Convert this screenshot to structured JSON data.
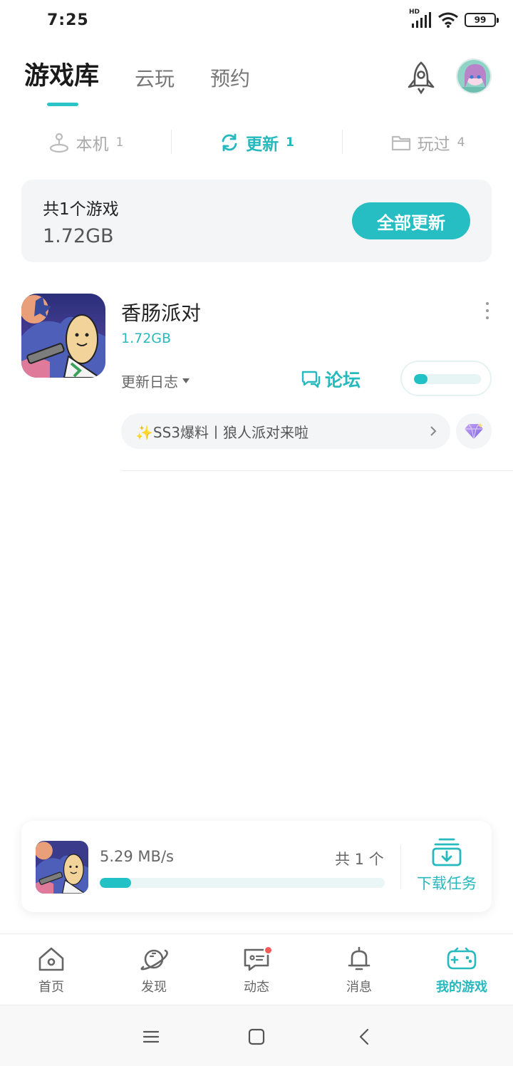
{
  "status_bar": {
    "time": "7:25",
    "network": "HD",
    "battery": "99"
  },
  "header": {
    "tabs": [
      {
        "label": "游戏库",
        "active": true
      },
      {
        "label": "云玩",
        "active": false
      },
      {
        "label": "预约",
        "active": false
      }
    ],
    "rocket_icon": "rocket-icon",
    "avatar_icon": "avatar"
  },
  "sub_tabs": [
    {
      "label": "本机",
      "count": "1",
      "icon": "device-icon",
      "active": false
    },
    {
      "label": "更新",
      "count": "1",
      "icon": "refresh-icon",
      "active": true
    },
    {
      "label": "玩过",
      "count": "4",
      "icon": "folder-icon",
      "active": false
    }
  ],
  "summary": {
    "title": "共1个游戏",
    "size": "1.72GB",
    "update_all": "全部更新"
  },
  "game": {
    "name": "香肠派对",
    "size": "1.72GB",
    "changelog": "更新日志",
    "forum": "论坛",
    "progress": 0.2,
    "news": "✨SS3爆料丨狼人派对来啦",
    "accent": "#26b9bd"
  },
  "download": {
    "speed": "5.29 MB/s",
    "count": "共 1 个",
    "progress": 0.11,
    "tasks_label": "下载任务"
  },
  "bottom_nav": [
    {
      "label": "首页",
      "icon": "home-icon",
      "active": false
    },
    {
      "label": "发现",
      "icon": "planet-icon",
      "active": false
    },
    {
      "label": "动态",
      "icon": "chat-icon",
      "active": false,
      "badge": true
    },
    {
      "label": "消息",
      "icon": "bell-icon",
      "active": false
    },
    {
      "label": "我的游戏",
      "icon": "gamepad-icon",
      "active": true
    }
  ]
}
